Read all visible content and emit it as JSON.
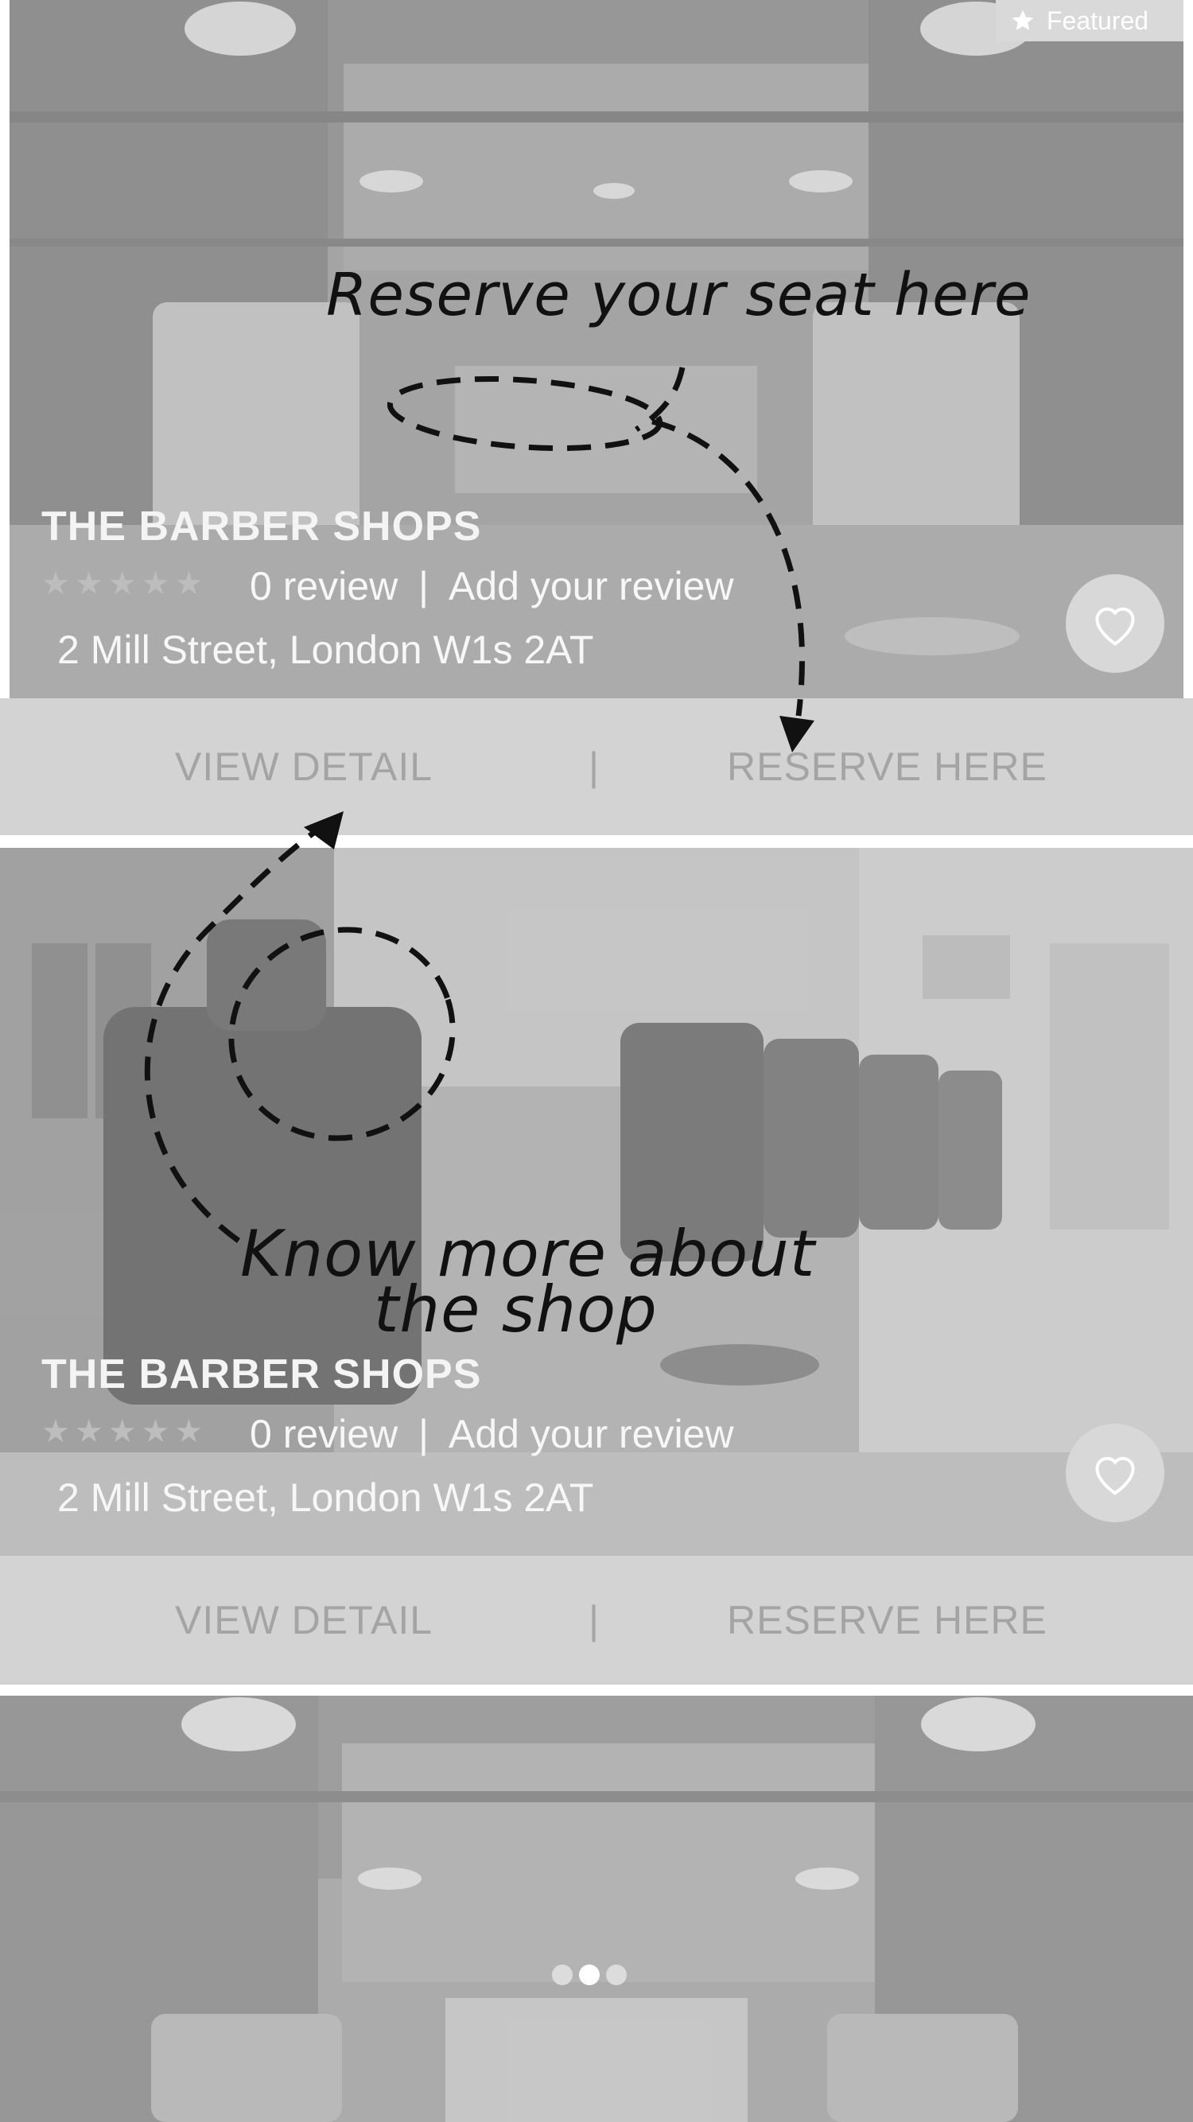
{
  "badge": {
    "label": "Featured",
    "icon": "star-icon"
  },
  "cards": [
    {
      "name": "THE BARBER SHOPS",
      "stars": "★★★★★",
      "review_count": "0 review",
      "review_sep": "|",
      "add_review": "Add your review",
      "address": "2 Mill Street, London W1s 2AT",
      "view_detail": "VIEW DETAIL",
      "divider": "|",
      "reserve": "RESERVE HERE"
    },
    {
      "name": "THE BARBER SHOPS",
      "stars": "★★★★★",
      "review_count": "0 review",
      "review_sep": "|",
      "add_review": "Add your review",
      "address": "2 Mill Street, London W1s 2AT",
      "view_detail": "VIEW DETAIL",
      "divider": "|",
      "reserve": "RESERVE HERE"
    }
  ],
  "annotations": {
    "reserve": "Reserve your seat here",
    "know_more_line1": "Know more about",
    "know_more_line2": "the shop"
  },
  "carousel": {
    "count": 3,
    "active_index": 1
  }
}
